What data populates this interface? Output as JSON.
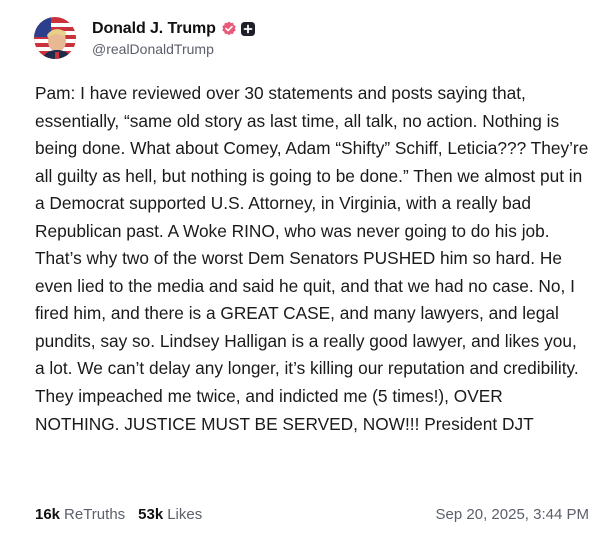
{
  "author": {
    "display_name": "Donald J. Trump",
    "handle": "@realDonaldTrump",
    "verified_icon": "verified-badge-icon",
    "plus_icon": "plus-badge-icon"
  },
  "post": {
    "text": "Pam: I have reviewed over 30 statements and posts saying that, essentially, “same old story as last time, all talk, no action. Nothing is being done. What about Comey, Adam “Shifty” Schiff, Leticia??? They’re all guilty as hell, but nothing is going to be done.” Then we almost put in a Democrat supported U.S. Attorney, in Virginia, with a really bad Republican past. A Woke RINO, who was never going to do his job. That’s why two of the worst Dem Senators PUSHED him so hard. He even lied to the media and said he quit, and that we had no case. No, I fired him, and there is a GREAT CASE, and many lawyers, and legal pundits, say so. Lindsey Halligan is a really good lawyer, and likes you, a lot. We can’t delay any longer, it’s killing our reputation and credibility. They impeached me twice, and indicted me (5 times!), OVER NOTHING. JUSTICE MUST BE SERVED, NOW!!! President DJT"
  },
  "stats": {
    "retruths_count": "16k",
    "retruths_label": "ReTruths",
    "likes_count": "53k",
    "likes_label": "Likes"
  },
  "timestamp": "Sep 20, 2025, 3:44 PM",
  "colors": {
    "verified": "#e85a7a",
    "text": "#1a1a1a",
    "muted": "#5c5f6b"
  }
}
